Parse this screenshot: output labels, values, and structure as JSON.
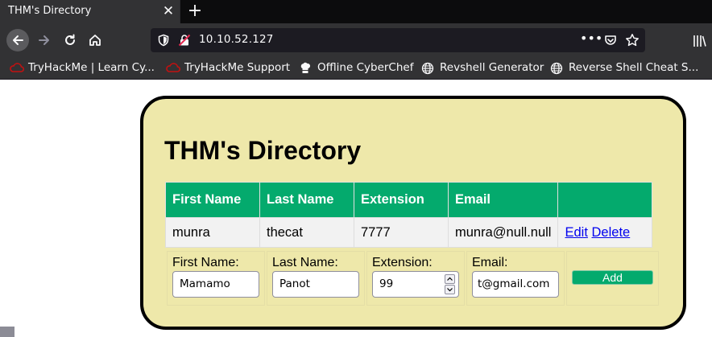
{
  "browser": {
    "tab_title": "THM's Directory",
    "tab_close": "✕",
    "new_tab": "+",
    "url": "10.10.52.127",
    "url_actions_dots": "•••",
    "bookmarks": [
      {
        "label": "TryHackMe | Learn Cy...",
        "icon": "tryhackme-icon"
      },
      {
        "label": "TryHackMe Support",
        "icon": "tryhackme-icon"
      },
      {
        "label": "Offline CyberChef",
        "icon": "chef-hat-icon"
      },
      {
        "label": "Revshell Generator",
        "icon": "globe-icon"
      },
      {
        "label": "Reverse Shell Cheat S...",
        "icon": "globe-icon"
      }
    ]
  },
  "page": {
    "title": "THM's Directory",
    "table": {
      "headers": [
        "First Name",
        "Last Name",
        "Extension",
        "Email",
        ""
      ],
      "rows": [
        {
          "first": "munra",
          "last": "thecat",
          "ext": "7777",
          "email": "munra@null.null",
          "edit": "Edit",
          "delete": "Delete"
        }
      ]
    },
    "form": {
      "first_label": "First Name:",
      "first_value": "Mamamo",
      "last_label": "Last Name:",
      "last_value": "Panot",
      "ext_label": "Extension:",
      "ext_value": "99",
      "email_label": "Email:",
      "email_value": "t@gmail.com",
      "add_label": "Add"
    }
  },
  "colors": {
    "card_bg": "#eee8aa",
    "header_green": "#04aa6d",
    "link": "#0000ee"
  }
}
